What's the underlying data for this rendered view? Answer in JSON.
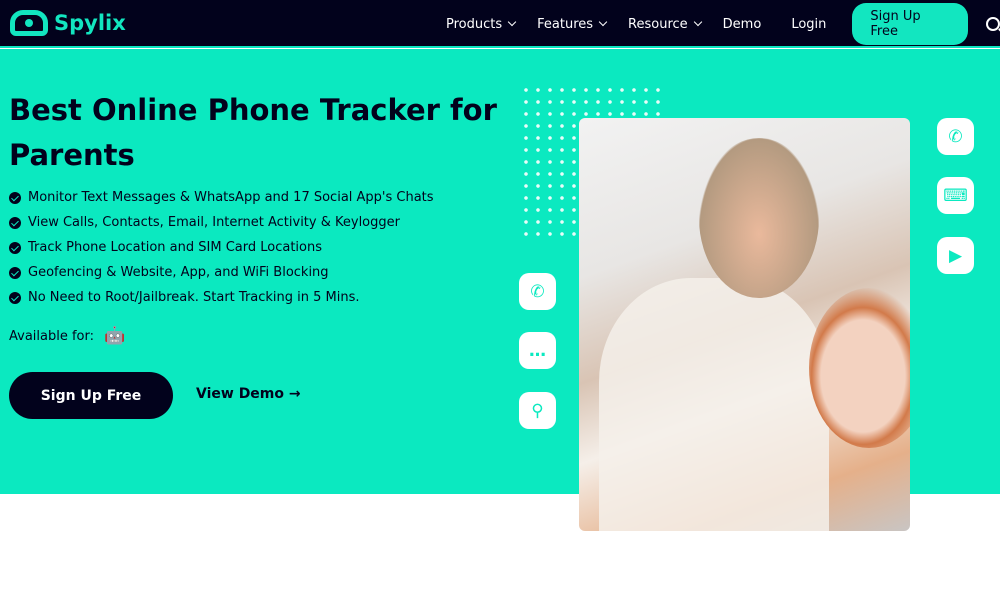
{
  "brand": {
    "name": "Spylix",
    "accent": "#0be9c0",
    "dark": "#02021c"
  },
  "nav": {
    "items": [
      {
        "label": "Products",
        "dropdown": true
      },
      {
        "label": "Features",
        "dropdown": true
      },
      {
        "label": "Resource",
        "dropdown": true
      },
      {
        "label": "Demo",
        "dropdown": false
      },
      {
        "label": "Login",
        "dropdown": false
      }
    ],
    "signup": "Sign Up Free",
    "search_icon": "search-icon"
  },
  "hero": {
    "title": "Best Online Phone Tracker for Parents",
    "features": [
      "Monitor Text Messages & WhatsApp and 17 Social App's Chats",
      "View Calls, Contacts, Email, Internet Activity & Keylogger",
      "Track Phone Location and SIM Card Locations",
      "Geofencing & Website, App, and WiFi Blocking",
      "No Need to Root/Jailbreak. Start Tracking in 5 Mins."
    ],
    "available_label": "Available for:",
    "platforms": [
      "android-icon",
      "apple-icon"
    ],
    "cta": "Sign Up Free",
    "demo": "View Demo →"
  },
  "floating_icons": {
    "left": [
      "whatsapp-icon",
      "chat-icon",
      "location-icon"
    ],
    "right": [
      "phone-icon",
      "keyboard-icon",
      "video-icon"
    ]
  }
}
